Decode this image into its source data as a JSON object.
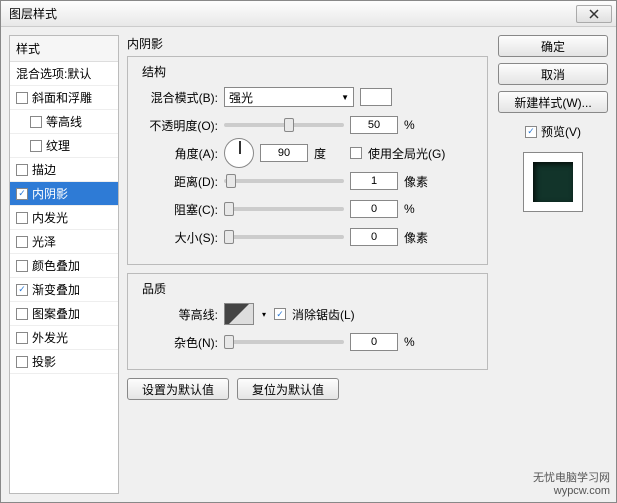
{
  "window": {
    "title": "图层样式"
  },
  "sidebar": {
    "header": "样式",
    "blend_defaults": "混合选项:默认",
    "items": [
      {
        "label": "斜面和浮雕",
        "checked": false
      },
      {
        "label": "等高线",
        "checked": false,
        "indent": true
      },
      {
        "label": "纹理",
        "checked": false,
        "indent": true
      },
      {
        "label": "描边",
        "checked": false
      },
      {
        "label": "内阴影",
        "checked": true,
        "selected": true
      },
      {
        "label": "内发光",
        "checked": false
      },
      {
        "label": "光泽",
        "checked": false
      },
      {
        "label": "颜色叠加",
        "checked": false
      },
      {
        "label": "渐变叠加",
        "checked": true
      },
      {
        "label": "图案叠加",
        "checked": false
      },
      {
        "label": "外发光",
        "checked": false
      },
      {
        "label": "投影",
        "checked": false
      }
    ]
  },
  "panel": {
    "title": "内阴影",
    "structure": {
      "legend": "结构",
      "blend_mode_label": "混合模式(B):",
      "blend_mode_value": "强光",
      "opacity_label": "不透明度(O):",
      "opacity_value": "50",
      "opacity_unit": "%",
      "angle_label": "角度(A):",
      "angle_value": "90",
      "angle_unit": "度",
      "global_light_label": "使用全局光(G)",
      "global_light_checked": false,
      "distance_label": "距离(D):",
      "distance_value": "1",
      "distance_unit": "像素",
      "choke_label": "阻塞(C):",
      "choke_value": "0",
      "choke_unit": "%",
      "size_label": "大小(S):",
      "size_value": "0",
      "size_unit": "像素"
    },
    "quality": {
      "legend": "品质",
      "contour_label": "等高线:",
      "antialias_label": "消除锯齿(L)",
      "antialias_checked": true,
      "noise_label": "杂色(N):",
      "noise_value": "0",
      "noise_unit": "%"
    },
    "buttons": {
      "make_default": "设置为默认值",
      "reset_default": "复位为默认值"
    }
  },
  "right": {
    "ok": "确定",
    "cancel": "取消",
    "new_style": "新建样式(W)...",
    "preview_label": "预览(V)",
    "preview_checked": true
  },
  "watermark": {
    "line1": "无忧电脑学习网",
    "line2": "wypcw.com"
  }
}
